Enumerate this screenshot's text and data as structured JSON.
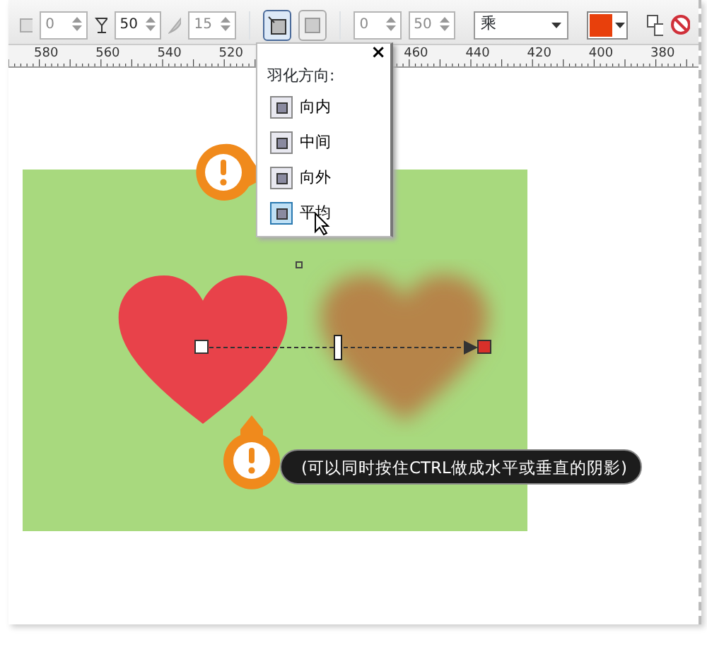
{
  "toolbar": {
    "items": [
      {
        "kind": "spin",
        "value": "0",
        "disabled": true
      },
      {
        "kind": "spin",
        "value": "50",
        "disabled": false
      },
      {
        "kind": "spin",
        "value": "15",
        "disabled": true
      },
      {
        "kind": "toggle",
        "selected": true
      },
      {
        "kind": "toggle",
        "selected": false
      },
      {
        "kind": "spin",
        "value": "0",
        "disabled": true
      },
      {
        "kind": "spin",
        "value": "50",
        "disabled": true
      },
      {
        "kind": "select",
        "value": "乘"
      },
      {
        "kind": "color",
        "color": "#e8400c"
      }
    ]
  },
  "ruler": {
    "labels": [
      "580",
      "560",
      "540",
      "520",
      "460",
      "440",
      "420",
      "400",
      "380"
    ]
  },
  "feather_popup": {
    "close": "×",
    "title": "羽化方向:",
    "items": [
      {
        "label": "向内",
        "selected": false
      },
      {
        "label": "中间",
        "selected": false
      },
      {
        "label": "向外",
        "selected": false
      },
      {
        "label": "平均",
        "selected": true
      }
    ]
  },
  "callout": {
    "text": "(可以同时按住CTRL做成水平或垂直的阴影)"
  }
}
